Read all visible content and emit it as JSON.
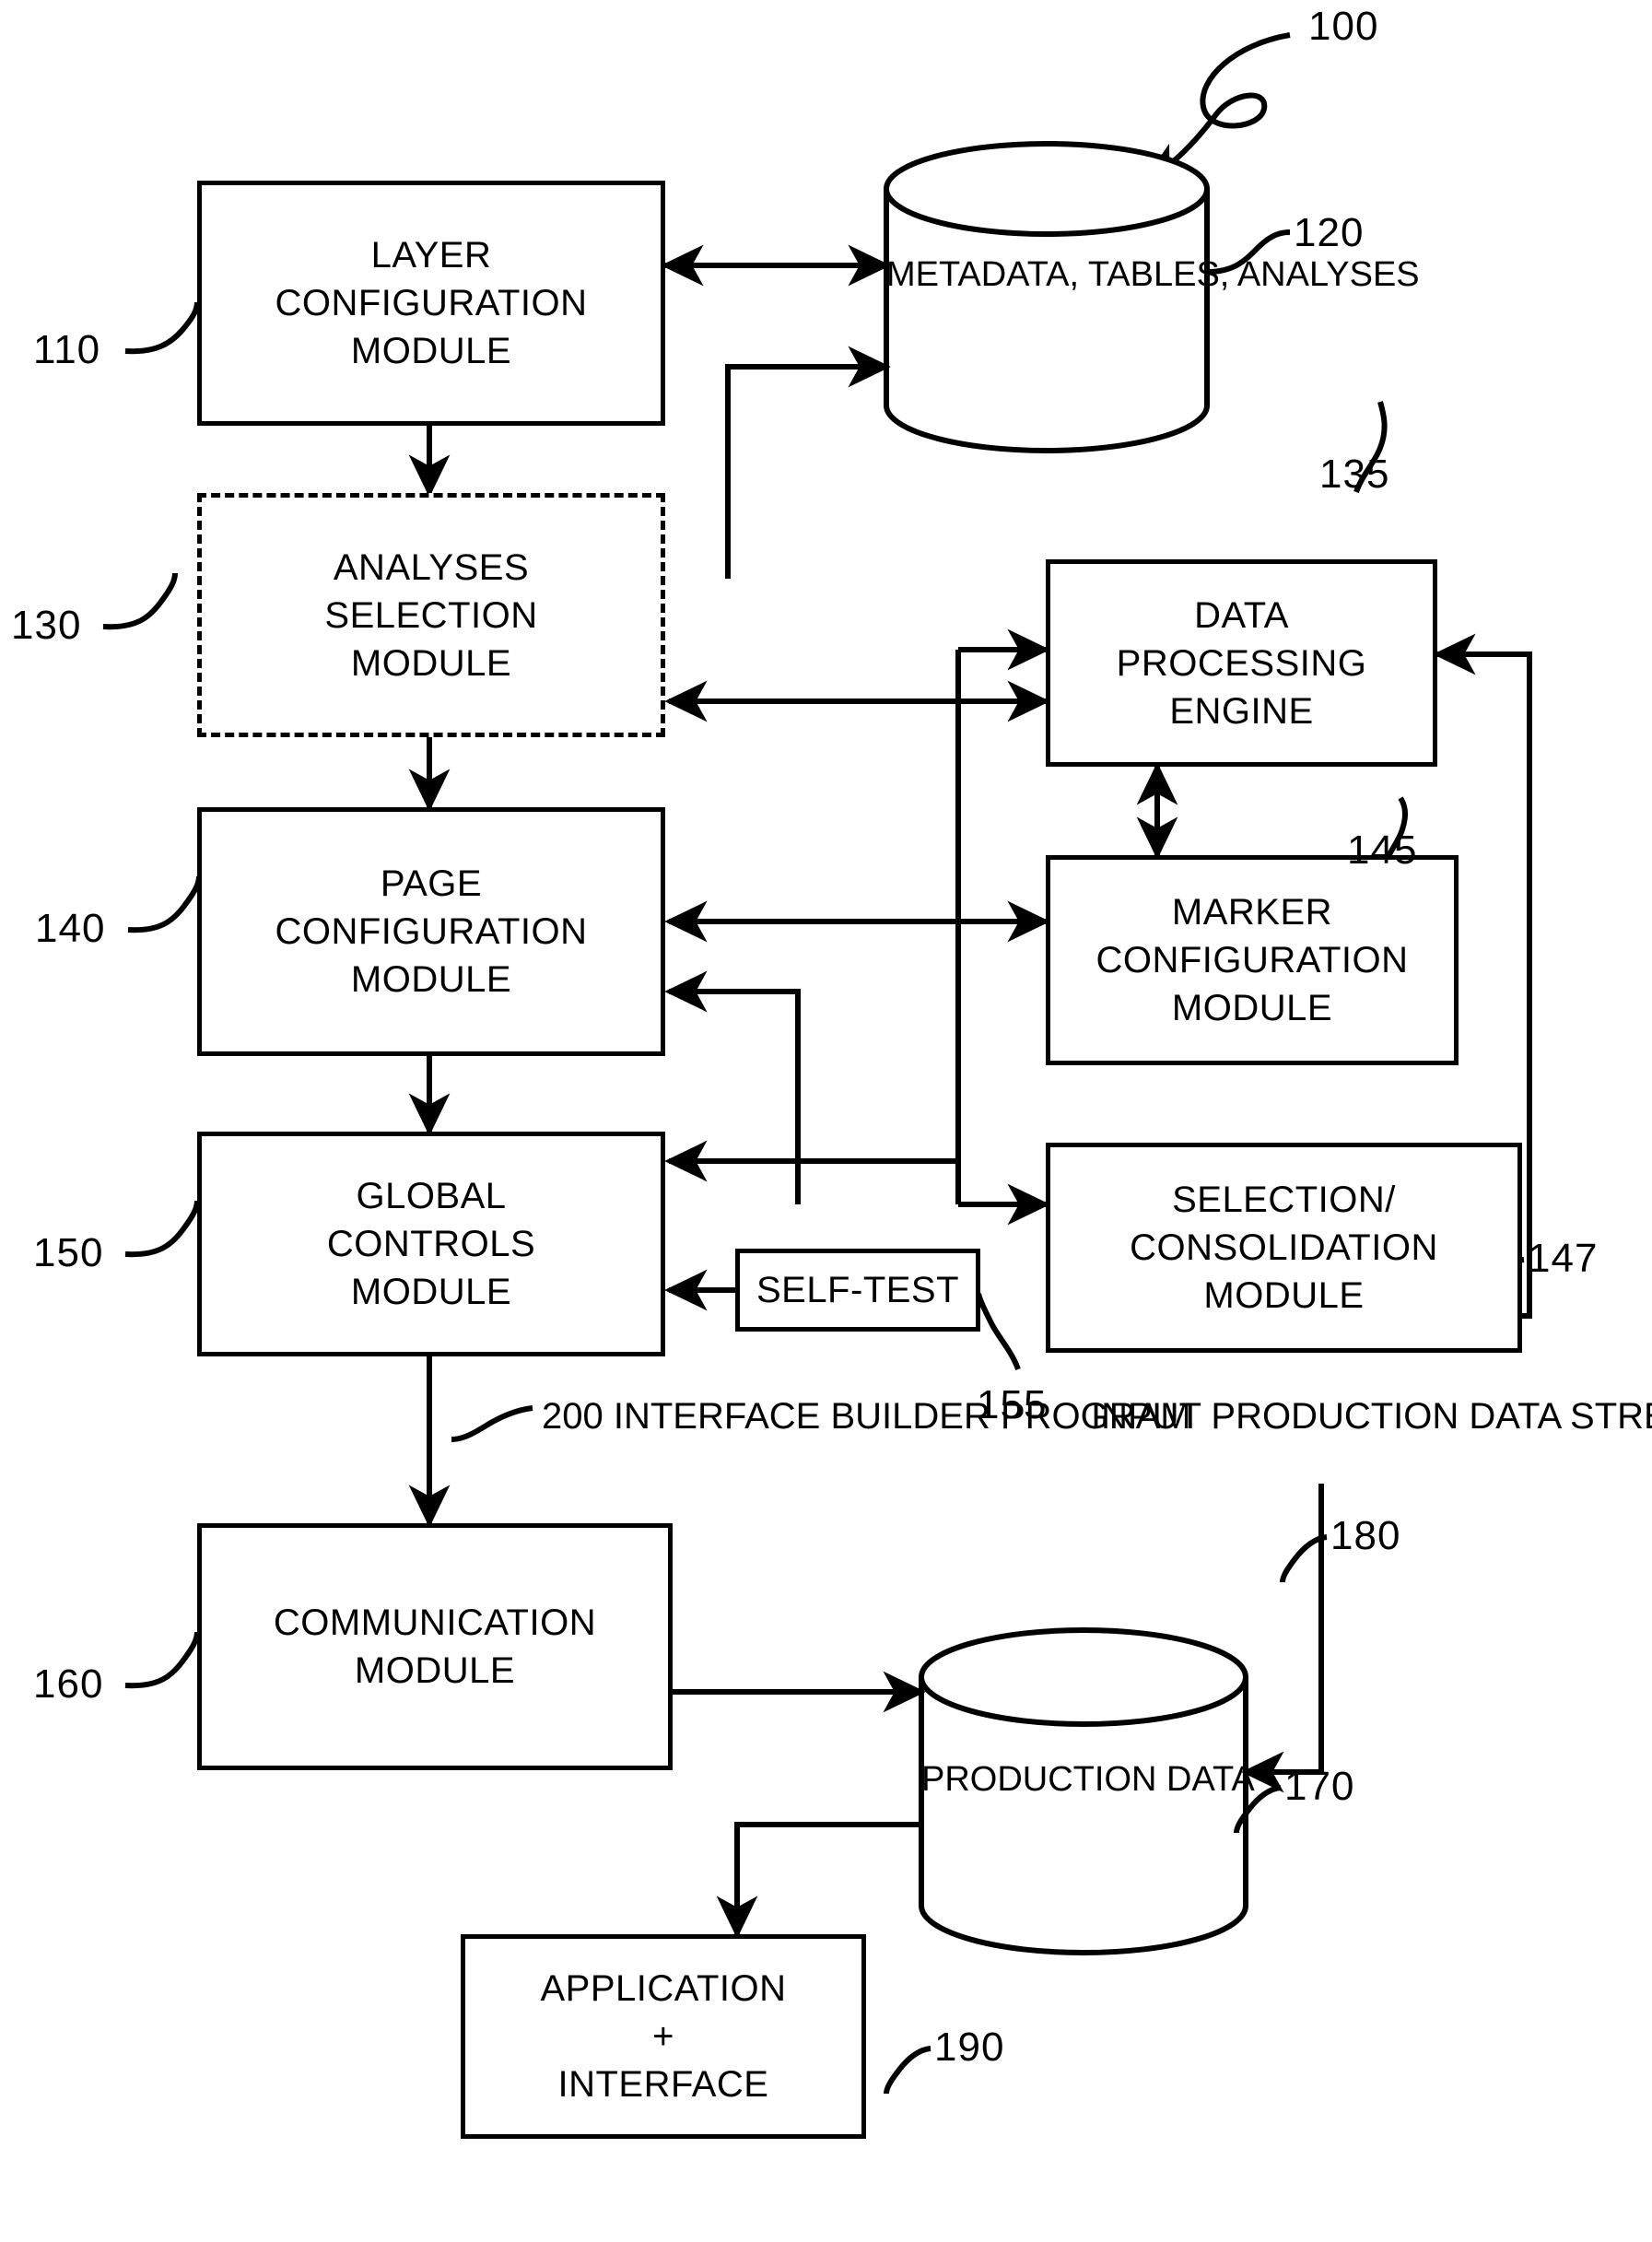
{
  "figure": {
    "reference": "100",
    "type": "patent-block-diagram"
  },
  "blocks": {
    "layer_configuration": {
      "lines": [
        "LAYER",
        "CONFIGURATION",
        "MODULE"
      ],
      "ref": "110"
    },
    "metadata_store": {
      "lines": [
        "METADATA,",
        "TABLES,",
        "ANALYSES"
      ],
      "ref": "120"
    },
    "analyses_selection": {
      "lines": [
        "ANALYSES",
        "SELECTION",
        "MODULE"
      ],
      "ref": "130"
    },
    "data_processing": {
      "lines": [
        "DATA",
        "PROCESSING",
        "ENGINE"
      ],
      "ref": "135"
    },
    "page_configuration": {
      "lines": [
        "PAGE",
        "CONFIGURATION",
        "MODULE"
      ],
      "ref": "140"
    },
    "marker_configuration": {
      "lines": [
        "MARKER",
        "CONFIGURATION",
        "MODULE"
      ],
      "ref": "145"
    },
    "global_controls": {
      "lines": [
        "GLOBAL",
        "CONTROLS",
        "MODULE"
      ],
      "ref": "150"
    },
    "selection_consolidation": {
      "lines": [
        "SELECTION/",
        "CONSOLIDATION",
        "MODULE"
      ],
      "ref": "147"
    },
    "self_test": {
      "lines": [
        "SELF-TEST"
      ],
      "ref": "155"
    },
    "communication": {
      "lines": [
        "COMMUNICATION",
        "MODULE"
      ],
      "ref": "160"
    },
    "production_data": {
      "lines": [
        "PRODUCTION",
        "DATA"
      ],
      "ref": "170"
    },
    "application_interface": {
      "lines": [
        "APPLICATION",
        "+",
        "INTERFACE"
      ],
      "ref": "190"
    }
  },
  "annotations": {
    "interface_builder": {
      "ref": "200",
      "lines": [
        "200   INTERFACE",
        "BUILDER PROGRAM"
      ]
    },
    "input_stream": {
      "ref": "180",
      "lines": [
        "INPUT PRODUCTION",
        "DATA STREAM"
      ]
    }
  },
  "colors": {
    "ink": "#000000",
    "paper": "#ffffff"
  }
}
